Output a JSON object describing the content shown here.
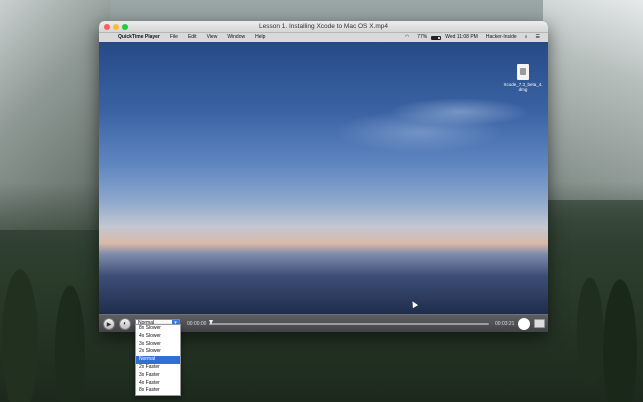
{
  "window": {
    "title": "Lesson 1. Installing Xcode to Mac OS X.mp4"
  },
  "menubar": {
    "apple_icon": "apple-icon",
    "items": [
      "QuickTime Player",
      "File",
      "Edit",
      "View",
      "Window",
      "Help"
    ],
    "battery": "77%",
    "clock": "Wed 11:08 PM",
    "user": "Hacker-Inside"
  },
  "desktop_icon": {
    "label_line1": "Xcode_7.3_beta_4.",
    "label_line2": "dmg"
  },
  "controls": {
    "speed_value": "Normal",
    "time_elapsed": "00:00:00",
    "time_remaining": "00:03:21",
    "progress": 0.0
  },
  "speed_menu": {
    "items": [
      "8x Slower",
      "4x Slower",
      "3x Slower",
      "2x Slower",
      "Normal",
      "2x Faster",
      "3x Faster",
      "4x Faster",
      "8x Faster"
    ],
    "selected_index": 4
  },
  "dock_colors": [
    "#4f86d9",
    "#8a8a8a",
    "#3aa0e8",
    "#a9c9f0",
    "#d9a441",
    "#f4d23b",
    "#e05a3f",
    "#f0f0f0",
    "#e8b53a",
    "#3f9be0",
    "#d63b4e",
    "#f25c9a",
    "#b0b0b0",
    "#4a90d9",
    "#333333",
    "#f0c93a",
    "#4a6fa5",
    "#6aa8e8",
    "#cfcfcf",
    "#9ec3ea",
    "#c9c9c9"
  ]
}
